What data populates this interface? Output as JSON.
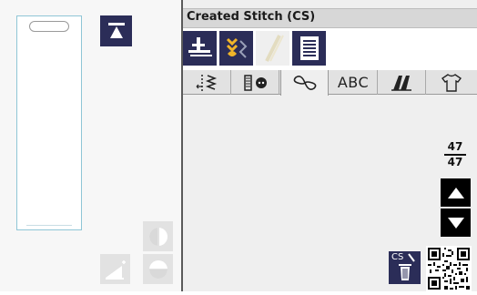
{
  "left_panel": {
    "preview_label": "stitch-preview",
    "top_button_icon": "move-to-top-icon",
    "mirror_icon": "mirror-icon",
    "resize_icon": "resize-icon",
    "rotate_icon": "rotate-icon"
  },
  "header": {
    "title": "Created Stitch (CS)"
  },
  "toolbar": {
    "tools": [
      "presser-foot-icon",
      "stitch-pattern-icon",
      "needle-icon",
      "memory-icon"
    ]
  },
  "tabs": [
    {
      "name": "utility-stitches",
      "icon": "utility-icon",
      "label": ""
    },
    {
      "name": "buttonholes",
      "icon": "buttonhole-icon",
      "label": ""
    },
    {
      "name": "decorative-stitches",
      "icon": "decorative-icon",
      "label": "",
      "active": true
    },
    {
      "name": "alphabets",
      "icon": "",
      "label": "ABC"
    },
    {
      "name": "quilt-stitches",
      "icon": "quilt-icon",
      "label": ""
    },
    {
      "name": "garment-stitches",
      "icon": "shirt-icon",
      "label": ""
    }
  ],
  "pager": {
    "current": "47",
    "total": "47"
  },
  "actions": {
    "cs_label": "CS"
  },
  "colors": {
    "navy": "#2b2d58",
    "accent_yellow": "#f0b429",
    "black": "#000000"
  }
}
